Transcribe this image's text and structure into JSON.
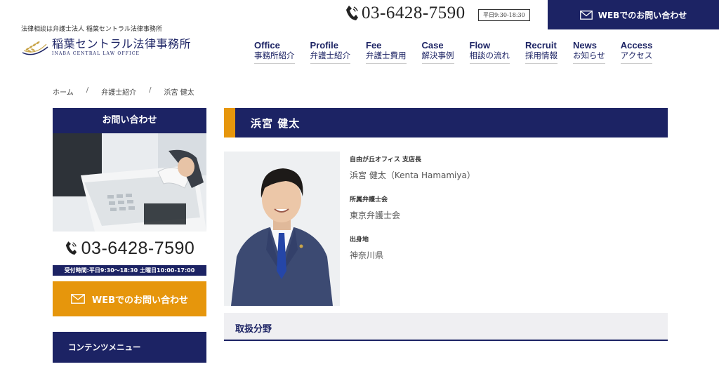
{
  "header": {
    "tagline": "法律相談は弁護士法人 稲葉セントラル法律事務所",
    "logo_jp": "稲葉セントラル法律事務所",
    "logo_en": "INABA CENTRAL LAW OFFICE",
    "phone": "03-6428-7590",
    "hours_badge": "平日9:30-18:30",
    "web_contact": "WEBでのお問い合わせ"
  },
  "nav": [
    {
      "en": "Office",
      "jp": "事務所紹介"
    },
    {
      "en": "Profile",
      "jp": "弁護士紹介"
    },
    {
      "en": "Fee",
      "jp": "弁護士費用"
    },
    {
      "en": "Case",
      "jp": "解決事例"
    },
    {
      "en": "Flow",
      "jp": "相談の流れ"
    },
    {
      "en": "Recruit",
      "jp": "採用情報"
    },
    {
      "en": "News",
      "jp": "お知らせ"
    },
    {
      "en": "Access",
      "jp": "アクセス"
    }
  ],
  "breadcrumb": {
    "home": "ホーム",
    "profile": "弁護士紹介",
    "current": "浜宮 健太",
    "separator": "/"
  },
  "sidebar": {
    "contact_title": "お問い合わせ",
    "phone": "03-6428-7590",
    "hours": "受付時間:平日9:30〜18:30 土曜日10:00-17:00",
    "web_contact": "WEBでのお問い合わせ",
    "menu_title": "コンテンツメニュー"
  },
  "profile": {
    "title": "浜宮 健太",
    "position_label": "自由が丘オフィス 支店長",
    "name_full": "浜宮 健太（Kenta Hamamiya）",
    "bar_label": "所属弁護士会",
    "bar_value": "東京弁護士会",
    "origin_label": "出身地",
    "origin_value": "神奈川県",
    "section_title": "取扱分野"
  },
  "colors": {
    "navy": "#1c2364",
    "orange": "#e6960c",
    "section_bg": "#efeff2"
  }
}
